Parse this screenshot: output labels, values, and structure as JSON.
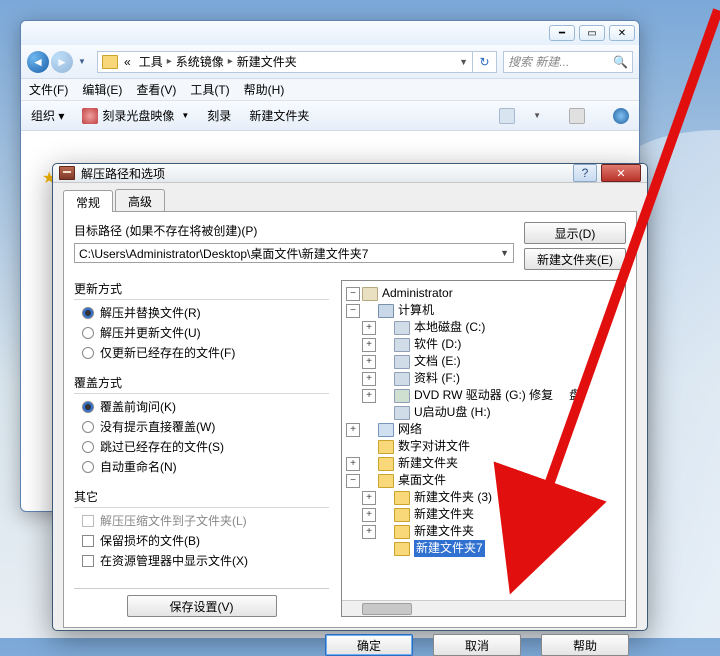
{
  "explorer": {
    "breadcrumb": {
      "pre": "«",
      "p1": "工具",
      "p2": "系统镜像",
      "p3": "新建文件夹"
    },
    "search_placeholder": "搜索 新建...",
    "menu": {
      "file": "文件(F)",
      "edit": "编辑(E)",
      "view": "查看(V)",
      "tools": "工具(T)",
      "help": "帮助(H)"
    },
    "toolbar": {
      "organize": "组织 ▾",
      "burn_img": "刻录光盘映像",
      "burn": "刻录",
      "newfolder": "新建文件夹"
    }
  },
  "dialog": {
    "title": "解压路径和选项",
    "tabs": {
      "general": "常规",
      "advanced": "高级"
    },
    "target_label": "目标路径 (如果不存在将被创建)(P)",
    "target_path": "C:\\Users\\Administrator\\Desktop\\桌面文件\\新建文件夹7",
    "btn_display": "显示(D)",
    "btn_newfolder": "新建文件夹(E)",
    "update": {
      "title": "更新方式",
      "r1": "解压并替换文件(R)",
      "r2": "解压并更新文件(U)",
      "r3": "仅更新已经存在的文件(F)"
    },
    "overwrite": {
      "title": "覆盖方式",
      "r1": "覆盖前询问(K)",
      "r2": "没有提示直接覆盖(W)",
      "r3": "跳过已经存在的文件(S)",
      "r4": "自动重命名(N)"
    },
    "misc": {
      "title": "其它",
      "c1": "解压压缩文件到子文件夹(L)",
      "c2": "保留损坏的文件(B)",
      "c3": "在资源管理器中显示文件(X)"
    },
    "save_settings": "保存设置(V)",
    "tree": {
      "n0": "Administrator",
      "n1": "计算机",
      "n2": "本地磁盘 (C:)",
      "n3": "软件 (D:)",
      "n4": "文档 (E:)",
      "n5": "资料 (F:)",
      "n6a": "DVD RW 驱动器 (G:)",
      "n6b": "修复",
      "n6c": "盘",
      "n7": "U启动U盘 (H:)",
      "n8": "网络",
      "n9": "数字对讲文件",
      "n10": "新建文件夹",
      "n11": "桌面文件",
      "n12": "新建文件夹 (3)",
      "n13": "新建文件夹",
      "n14": "新建文件夹",
      "n15": "新建文件夹7"
    },
    "buttons": {
      "ok": "确定",
      "cancel": "取消",
      "help": "帮助"
    }
  }
}
